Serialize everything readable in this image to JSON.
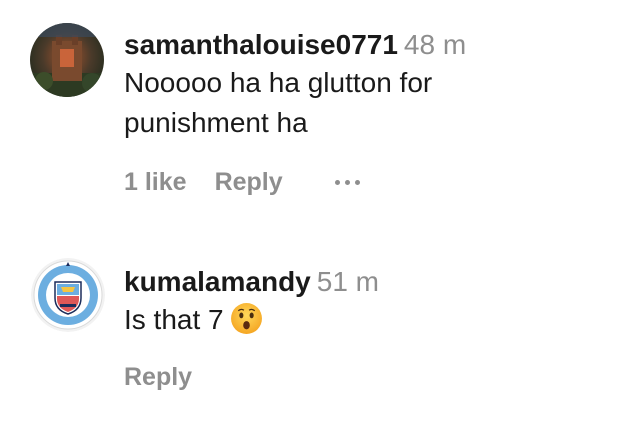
{
  "comments": [
    {
      "username": "samanthalouise0771",
      "time": "48 m",
      "text_lines": [
        "Nooooo ha ha glutton for",
        "punishment ha"
      ],
      "likes": "1 like",
      "reply": "Reply",
      "avatar": "profile-photo-icon"
    },
    {
      "username": "kumalamandy",
      "time": "51 m",
      "text": "Is that 7",
      "emoji": "astonished-face-icon",
      "reply": "Reply",
      "avatar": "manchester-city-crest-icon"
    }
  ],
  "more_icon": "ellipsis-icon",
  "colors": {
    "primary_text": "#1a1a1a",
    "secondary_text": "#8e8e8e",
    "city_blue": "#6caee0"
  }
}
